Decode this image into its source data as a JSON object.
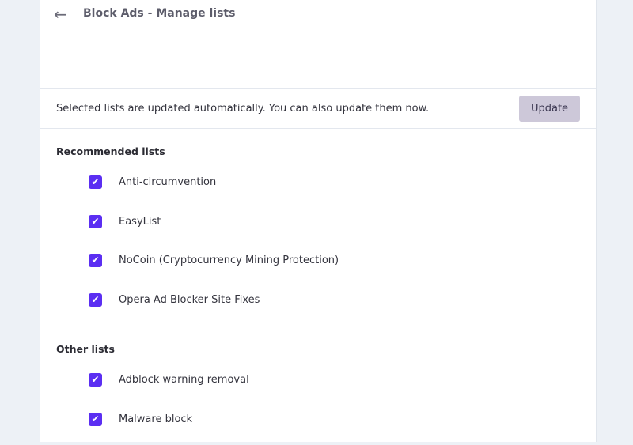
{
  "header": {
    "title": "Block Ads - Manage lists"
  },
  "update": {
    "text": "Selected lists are updated automatically. You can also update them now.",
    "button": "Update"
  },
  "recommended": {
    "title": "Recommended lists",
    "items": [
      {
        "label": "Anti-circumvention",
        "checked": true
      },
      {
        "label": "EasyList",
        "checked": true
      },
      {
        "label": "NoCoin (Cryptocurrency Mining Protection)",
        "checked": true
      },
      {
        "label": "Opera Ad Blocker Site Fixes",
        "checked": true
      }
    ]
  },
  "other": {
    "title": "Other lists",
    "items": [
      {
        "label": "Adblock warning removal",
        "checked": true
      },
      {
        "label": "Malware block",
        "checked": true
      }
    ]
  },
  "colors": {
    "accent": "#5b2ef2",
    "button_bg": "#cdc8d9",
    "background": "#edf1f6"
  }
}
